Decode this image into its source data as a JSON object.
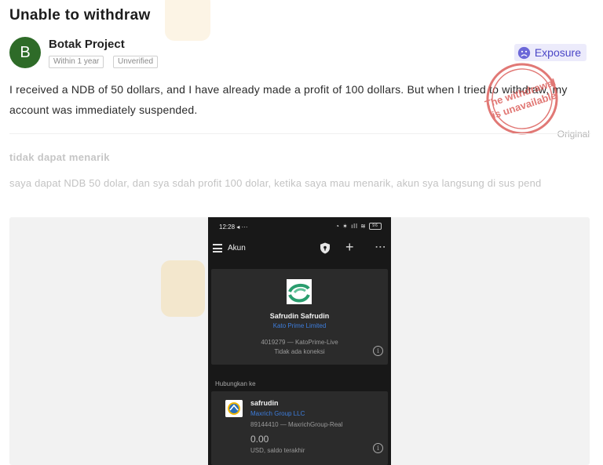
{
  "post": {
    "title": "Unable to withdraw",
    "author": {
      "initial": "B",
      "name": "Botak Project",
      "tags": [
        "Within 1 year",
        "Unverified"
      ],
      "avatar_color": "#2e6b28"
    },
    "category_badge": {
      "label": "Exposure",
      "icon": "sad-face-icon",
      "color": "#4b47c7"
    },
    "body": "I received a NDB of 50 dollars, and I have already made a profit of 100 dollars. But when I tried to withdraw, my account was immediately suspended.",
    "stamp": {
      "line1": "The withdrawal",
      "line2": "is unavailable",
      "color": "#d9534f"
    },
    "original_label": "Original",
    "translation": {
      "title": "tidak dapat menarik",
      "body": "saya dapat NDB 50 dolar, dan sya sdah profit 100 dolar, ketika saya mau menarik, akun sya langsung di sus pend"
    }
  },
  "phone": {
    "status_time": "12:28",
    "status_extra": "◂ ···",
    "battery": "96",
    "app_title": "Akun",
    "account": {
      "name": "Safrudin Safrudin",
      "company": "Kato Prime Limited",
      "number": "4019279 — KatoPrime-Live",
      "status": "Tidak ada koneksi"
    },
    "connect_label": "Hubungkan ke",
    "linked": {
      "name": "safrudin",
      "company": "Maxrich Group LLC",
      "number": "89144410 — MaxrichGroup-Real",
      "balance": "0.00",
      "balance_label": "USD, saldo terakhir"
    }
  }
}
